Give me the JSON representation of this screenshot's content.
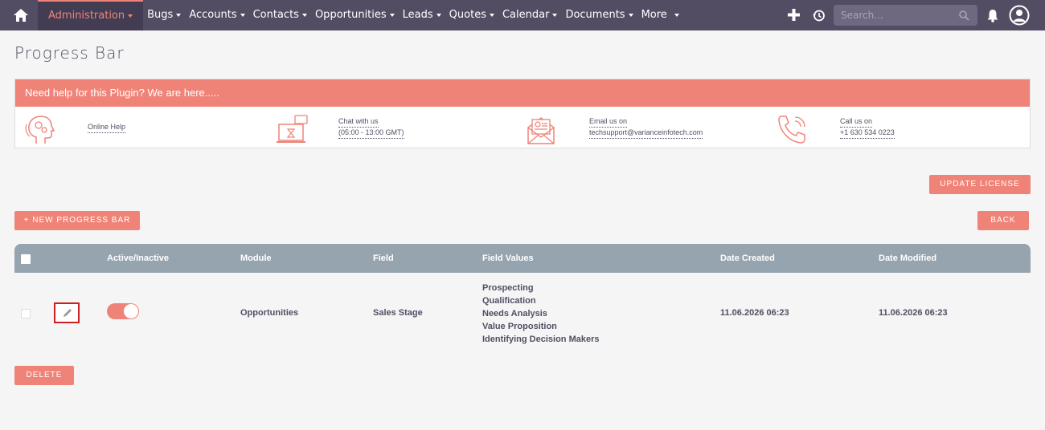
{
  "nav": {
    "items": [
      {
        "label": "Administration",
        "active": true
      },
      {
        "label": "Bugs"
      },
      {
        "label": "Accounts"
      },
      {
        "label": "Contacts"
      },
      {
        "label": "Opportunities"
      },
      {
        "label": "Leads"
      },
      {
        "label": "Quotes"
      },
      {
        "label": "Calendar"
      },
      {
        "label": "Documents"
      },
      {
        "label": "More"
      }
    ],
    "search_placeholder": "Search..."
  },
  "page": {
    "title": "Progress Bar"
  },
  "help": {
    "header": "Need help for this Plugin? We are here.....",
    "online_help": "Online Help",
    "chat_label": "Chat with us",
    "chat_hours": "(05:00 - 13:00 GMT)",
    "email_label": "Email us on",
    "email_value": "techsupport@varianceinfotech.com",
    "call_label": "Call us on",
    "call_value": "+1 630 534 0223"
  },
  "buttons": {
    "update_license": "UPDATE LICENSE",
    "new_progress_bar": "+ NEW PROGRESS BAR",
    "back": "BACK",
    "delete": "DELETE"
  },
  "table": {
    "columns": [
      "Active/Inactive",
      "Module",
      "Field",
      "Field Values",
      "Date Created",
      "Date Modified"
    ],
    "rows": [
      {
        "active": true,
        "module": "Opportunities",
        "field": "Sales Stage",
        "field_values": [
          "Prospecting",
          "Qualification",
          "Needs Analysis",
          "Value Proposition",
          "Identifying Decision Makers"
        ],
        "date_created": "11.06.2026 06:23",
        "date_modified": "11.06.2026 06:23"
      }
    ]
  },
  "colors": {
    "accent": "#f08377",
    "nav_bg": "#534d64",
    "table_head": "#96a4b0"
  }
}
